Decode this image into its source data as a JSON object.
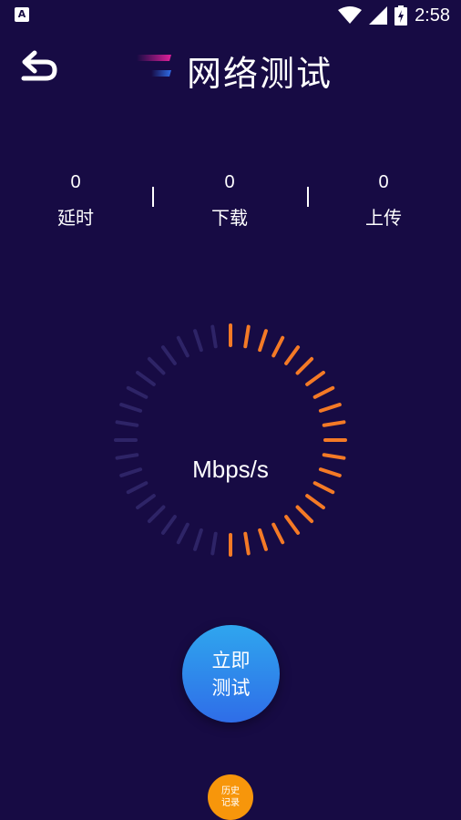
{
  "status_bar": {
    "notification_icon": "a11y-icon",
    "notification_glyph": "A",
    "time": "2:58",
    "icons": [
      "wifi-icon",
      "signal-icon",
      "battery-icon"
    ]
  },
  "header": {
    "title": "网络测试",
    "back_icon": "back-arrow-icon",
    "logo_icon": "speed-logo-icon"
  },
  "stats": [
    {
      "value": "0",
      "label": "延时"
    },
    {
      "value": "0",
      "label": "下载"
    },
    {
      "value": "0",
      "label": "上传"
    }
  ],
  "gauge": {
    "unit": "Mbps/s",
    "active_color": "#f47a26",
    "inactive_color": "#2e2467",
    "active_fraction": 0.5
  },
  "start_button": {
    "line1": "立即",
    "line2": "测试"
  },
  "history_button": {
    "line1": "历史",
    "line2": "记录"
  },
  "colors": {
    "background": "#170b44",
    "accent_orange": "#f7960b",
    "button_blue": "#2f8aea"
  }
}
